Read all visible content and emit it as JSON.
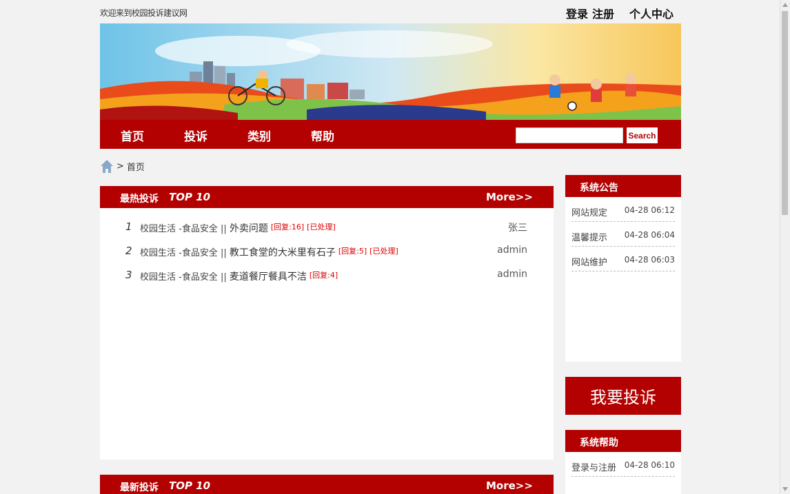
{
  "header": {
    "welcome": "欢迎来到校园投诉建议网",
    "login": "登录",
    "register": "注册",
    "user_center": "个人中心"
  },
  "nav": {
    "items": [
      {
        "label": "首页"
      },
      {
        "label": "投诉"
      },
      {
        "label": "类别"
      },
      {
        "label": "帮助"
      }
    ],
    "search_button": "Search",
    "search_value": ""
  },
  "breadcrumb": {
    "separator": ">",
    "current": "首页"
  },
  "hot_panel": {
    "title": "最热投诉",
    "subtitle": "TOP 10",
    "more": "More>>",
    "rows": [
      {
        "num": "1",
        "category": "校园生活 -食品安全 ||",
        "title": "外卖问题",
        "tags": [
          "[回复:16]",
          "[已处理]"
        ],
        "user": "张三"
      },
      {
        "num": "2",
        "category": "校园生活 -食品安全 ||",
        "title": "教工食堂的大米里有石子",
        "tags": [
          "[回复:5]",
          "[已处理]"
        ],
        "user": "admin"
      },
      {
        "num": "3",
        "category": "校园生活 -食品安全 ||",
        "title": "麦道餐厅餐具不洁",
        "tags": [
          "[回复:4]"
        ],
        "user": "admin"
      }
    ]
  },
  "new_panel": {
    "title": "最新投诉",
    "subtitle": "TOP 10",
    "more": "More>>"
  },
  "notice": {
    "title": "系统公告",
    "items": [
      {
        "label": "网站规定",
        "time": "04-28 06:12"
      },
      {
        "label": "温馨提示",
        "time": "04-28 06:04"
      },
      {
        "label": "网站维护",
        "time": "04-28 06:03"
      }
    ]
  },
  "complain_button": "我要投诉",
  "help": {
    "title": "系统帮助",
    "items": [
      {
        "label": "登录与注册",
        "time": "04-28 06:10"
      }
    ]
  },
  "colors": {
    "brand_red": "#b30000",
    "tag_red": "#dd0000",
    "page_bg": "#f2f2f2"
  }
}
